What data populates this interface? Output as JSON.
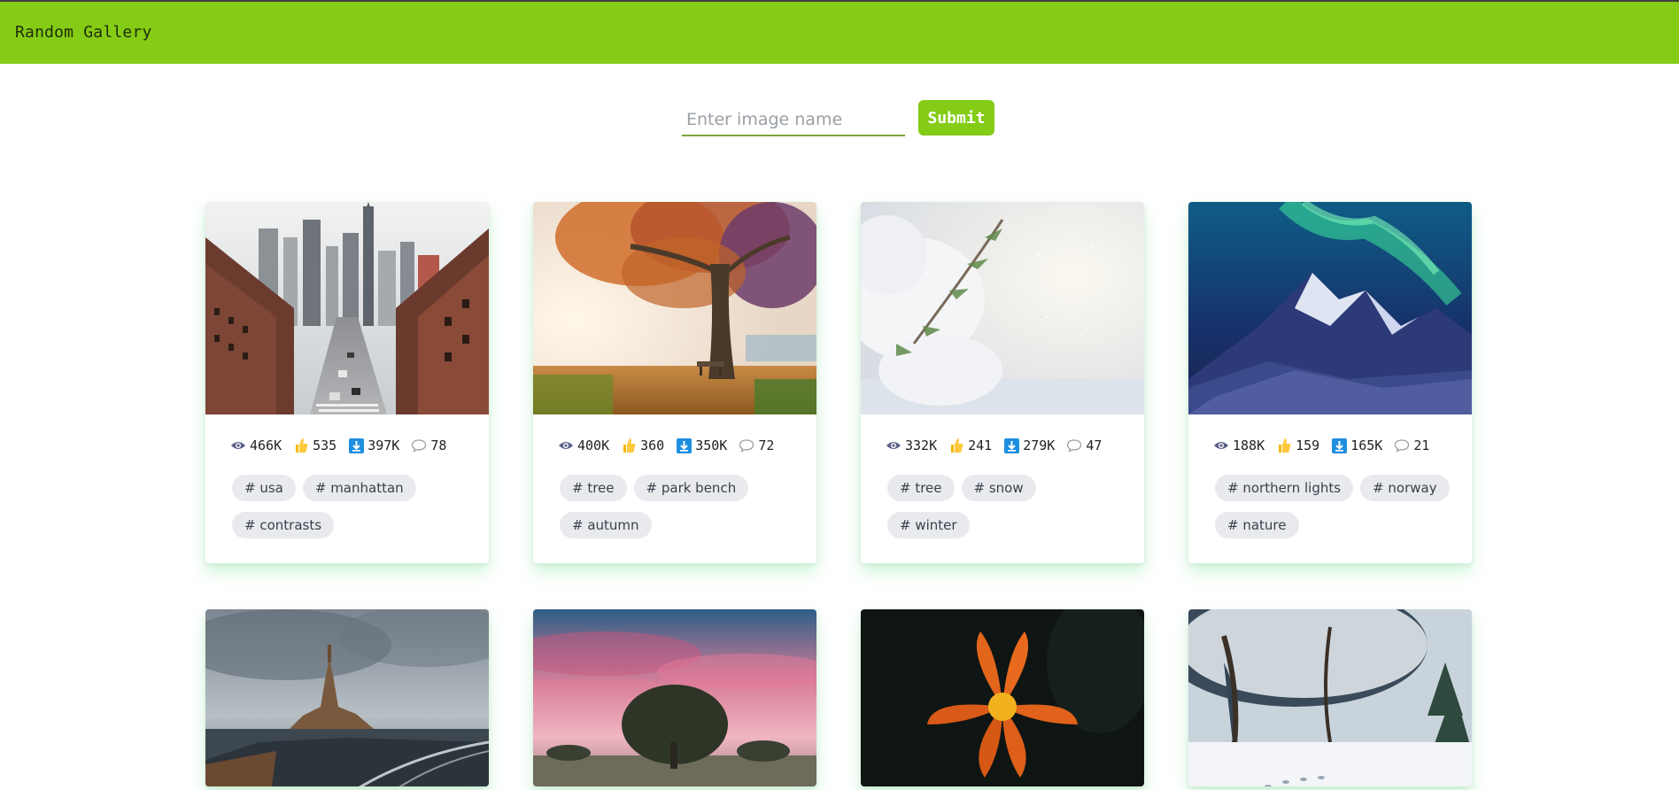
{
  "header": {
    "title": "Random Gallery",
    "color": "#84cc16"
  },
  "search": {
    "placeholder": "Enter image name",
    "value": "",
    "submit_label": "Submit"
  },
  "stat_icons": [
    "eye-icon",
    "thumbs-up-icon",
    "download-icon",
    "comment-icon"
  ],
  "cards": [
    {
      "views": "466K",
      "likes": "535",
      "downloads": "397K",
      "comments": "78",
      "tags": [
        "# usa",
        "# manhattan",
        "# contrasts"
      ]
    },
    {
      "views": "400K",
      "likes": "360",
      "downloads": "350K",
      "comments": "72",
      "tags": [
        "# tree",
        "# park bench",
        "# autumn"
      ]
    },
    {
      "views": "332K",
      "likes": "241",
      "downloads": "279K",
      "comments": "47",
      "tags": [
        "# tree",
        "# snow",
        "# winter"
      ]
    },
    {
      "views": "188K",
      "likes": "159",
      "downloads": "165K",
      "comments": "21",
      "tags": [
        "# northern lights",
        "# norway",
        "# nature"
      ]
    }
  ]
}
